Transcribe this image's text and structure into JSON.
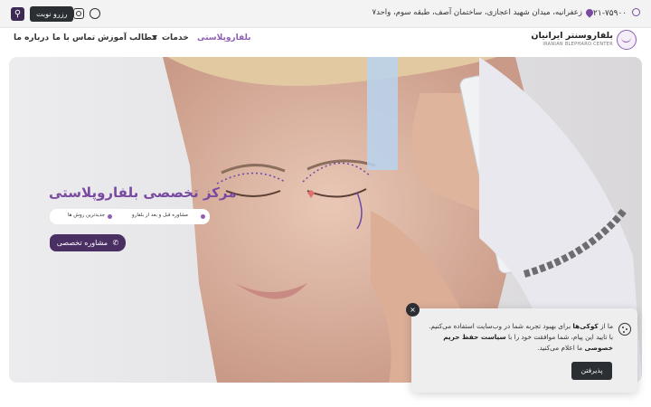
{
  "topbar": {
    "phone": "۰۲۱-۷۵۹۰۰",
    "address": "زعفرانیه، میدان شهید اعجازی، ساختمان آصف، طبقه سوم، واحد۷",
    "reserve_label": "رزرو نوبت",
    "icons": {
      "phone": "headset-icon",
      "address": "location-pin-icon",
      "search": "search-icon",
      "instagram": "instagram-icon",
      "whatsapp": "whatsapp-icon"
    }
  },
  "logo": {
    "title": "بلفاروسنتر ایرانیان",
    "subtitle": "IRANIAN BLEPHARO CENTER"
  },
  "nav": {
    "items": [
      {
        "label": "بلفاروپلاستی",
        "active": true
      },
      {
        "label": "خدمات",
        "has_dropdown": true
      },
      {
        "label": "مطالب آموزش"
      },
      {
        "label": "تماس با ما"
      },
      {
        "label": "درباره ما"
      }
    ]
  },
  "hero": {
    "title": "مرکز تخصصی بلفاروپلاستی",
    "pills": [
      "مشاوره قبل و بعد از بلفارو",
      "جدیدترین روش ها"
    ],
    "cta_label": "مشاوره تخصصی",
    "cta_icon": "phone-icon",
    "image": "patient-eyelid-marking-photo"
  },
  "cookie": {
    "text_start": "ما از ",
    "text_bold1": "کوکی‌ها",
    "text_mid": " برای بهبود تجربه شما در وب‌سایت استفاده می‌کنیم. با تایید این پیام، شما موافقت خود را با ",
    "text_bold2": "سیاست حفظ حریم خصوصی",
    "text_end": " ما اعلام می‌کنید.",
    "accept_label": "پذیرفتن",
    "close_label": "×"
  },
  "colors": {
    "brand_purple": "#7a4aa0",
    "dark_purple": "#4a2f63",
    "dark_button": "#2b2e33"
  }
}
